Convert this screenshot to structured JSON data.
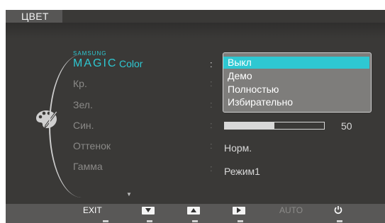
{
  "header": {
    "title": "ЦВЕТ"
  },
  "menu": {
    "magic_small": "SAMSUNG",
    "magic_big": "MAGIC",
    "magic_suffix": "Color",
    "items": [
      {
        "label": "Кр."
      },
      {
        "label": "Зел."
      },
      {
        "label": "Син."
      },
      {
        "label": "Оттенок"
      },
      {
        "label": "Гамма"
      }
    ],
    "colon": ":"
  },
  "dropdown": {
    "options": [
      "Выкл",
      "Демо",
      "Полностью",
      "Избирательно"
    ],
    "selected_index": 0
  },
  "blue_slider": {
    "value": 50,
    "value_text": "50",
    "fraction": 0.5
  },
  "values": {
    "tone": "Норм.",
    "gamma": "Режим1"
  },
  "bottom_bar": {
    "exit": "EXIT",
    "auto": "AUTO"
  },
  "colors": {
    "accent": "#2ec8d2",
    "osd_bg": "#3a3937",
    "bar_bg": "#595857"
  },
  "icons": {
    "category": "palette-icon",
    "down": "triangle-down-icon",
    "up": "triangle-up-icon",
    "enter": "triangle-right-icon",
    "power": "power-icon"
  }
}
